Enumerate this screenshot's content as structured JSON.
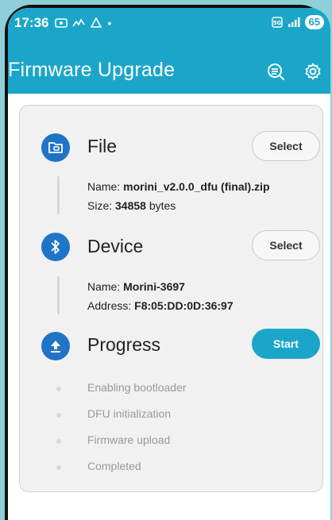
{
  "status_bar": {
    "time": "17:36",
    "battery": "65"
  },
  "app_bar": {
    "title": "Firmware Upgrade"
  },
  "file": {
    "title": "File",
    "select_label": "Select",
    "name_label": "Name:",
    "name_value": "morini_v2.0.0_dfu (final).zip",
    "size_label": "Size:",
    "size_value": "34858",
    "size_unit": "bytes"
  },
  "device": {
    "title": "Device",
    "select_label": "Select",
    "name_label": "Name:",
    "name_value": "Morini-3697",
    "address_label": "Address:",
    "address_value": "F8:05:DD:0D:36:97"
  },
  "progress": {
    "title": "Progress",
    "start_label": "Start",
    "steps": [
      "Enabling bootloader",
      "DFU initialization",
      "Firmware upload",
      "Completed"
    ]
  },
  "colors": {
    "accent": "#1ba6c9",
    "section_icon": "#1f74c6"
  },
  "icons": {
    "file": "folder-icon",
    "device": "bluetooth-icon",
    "progress": "upload-icon",
    "app_bar_left": "search-list-icon",
    "app_bar_right": "gear-icon"
  }
}
